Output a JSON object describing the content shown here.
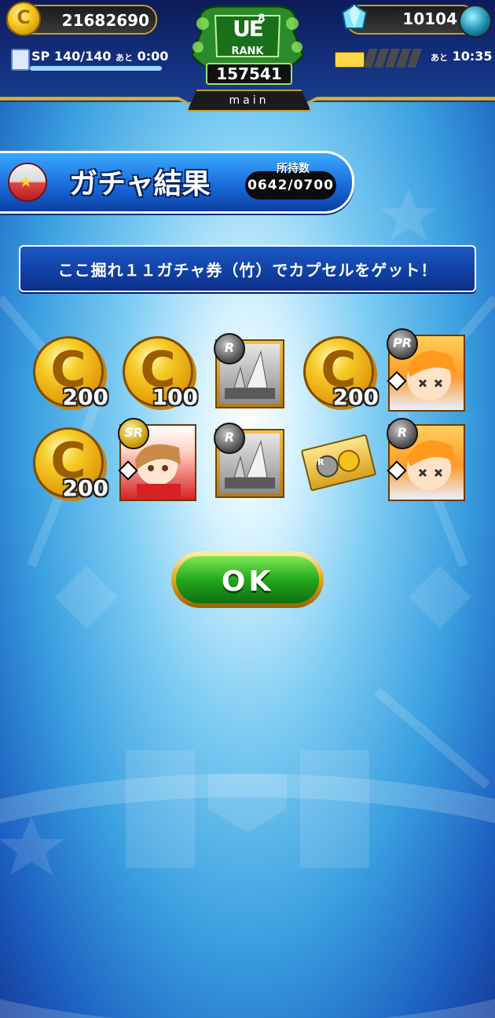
{
  "header": {
    "coins": "21682690",
    "sp_label": "SP",
    "sp_value": "140/140",
    "sp_time_prefix": "あと",
    "sp_time": "0:00",
    "gems": "10104",
    "stamina_time_prefix": "あと",
    "stamina_time": "10:35",
    "rank": {
      "letters": "UE",
      "level": "8",
      "label": "RANK",
      "points": "157541"
    },
    "mode_tab": "main"
  },
  "result": {
    "title": "ガチャ結果",
    "owned_label": "所持数",
    "owned_value": "0642/0700"
  },
  "message": "ここ掘れ１１ガチャ券（竹）でカプセルをゲット！",
  "items": [
    {
      "type": "coin",
      "quantity": "200"
    },
    {
      "type": "coin",
      "quantity": "100"
    },
    {
      "type": "trophy",
      "rarity": "R"
    },
    {
      "type": "coin",
      "quantity": "200"
    },
    {
      "type": "character",
      "rarity": "PR"
    },
    {
      "type": "coin",
      "quantity": "200"
    },
    {
      "type": "character",
      "rarity": "SR"
    },
    {
      "type": "trophy",
      "rarity": "R"
    },
    {
      "type": "ticket",
      "rarity": "R"
    },
    {
      "type": "character",
      "rarity": "R"
    }
  ],
  "ok_button": "OK",
  "colors": {
    "accent_blue": "#1867d6",
    "ok_green": "#23a81b",
    "gold": "#e0a713"
  }
}
